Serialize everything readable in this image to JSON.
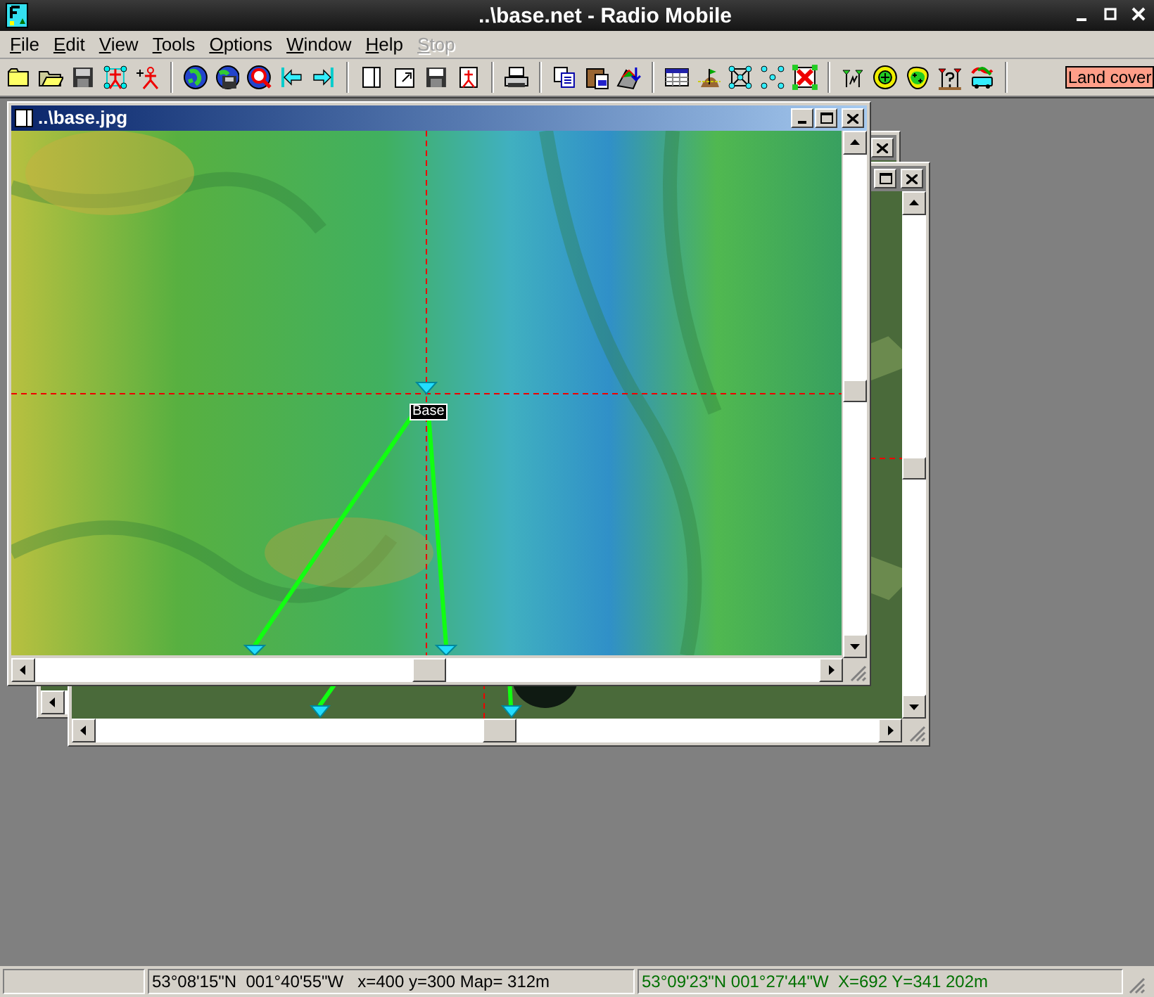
{
  "window": {
    "title": "..\\base.net - Radio Mobile"
  },
  "menu": [
    {
      "label": "File",
      "disabled": false
    },
    {
      "label": "Edit",
      "disabled": false
    },
    {
      "label": "View",
      "disabled": false
    },
    {
      "label": "Tools",
      "disabled": false
    },
    {
      "label": "Options",
      "disabled": false
    },
    {
      "label": "Window",
      "disabled": false
    },
    {
      "label": "Help",
      "disabled": false
    },
    {
      "label": "Stop",
      "disabled": true
    }
  ],
  "toolbar": {
    "land_cover_button": "Land cover"
  },
  "documents": [
    {
      "title": "..\\base.jpg",
      "active": true,
      "unit_label": "Base"
    }
  ],
  "status_bar": {
    "cursor": "53°08'15\"N  001°40'55\"W   x=400 y=300 Map= 312m",
    "selection": "53°09'23\"N 001°27'44\"W  X=692 Y=341 202m"
  }
}
